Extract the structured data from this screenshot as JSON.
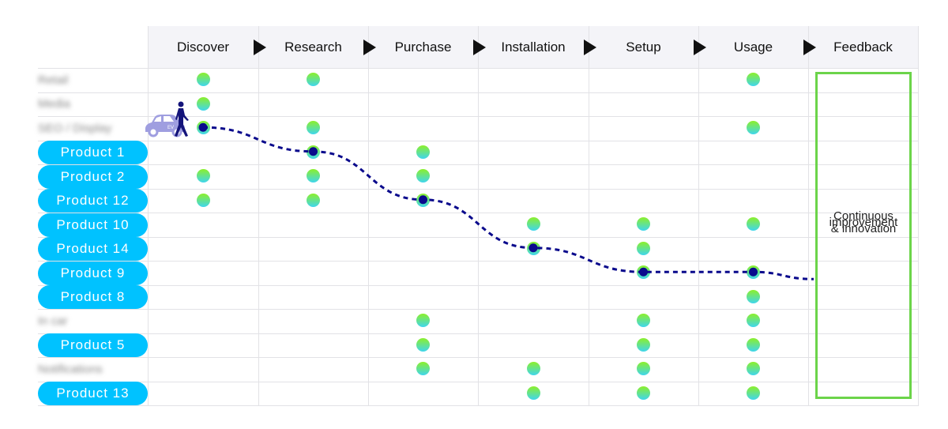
{
  "stages": [
    "Discover",
    "Research",
    "Purchase",
    "Installation",
    "Setup",
    "Usage",
    "Feedback"
  ],
  "rows": [
    {
      "label": "Retail",
      "style": "blur",
      "dots": [
        0,
        1,
        5
      ]
    },
    {
      "label": "Media",
      "style": "blur",
      "dots": [
        0
      ]
    },
    {
      "label": "SEO / Display",
      "style": "blur",
      "dots": [
        0,
        1,
        5
      ]
    },
    {
      "label": "Product 1",
      "style": "pill",
      "dots": [
        1,
        2
      ]
    },
    {
      "label": "Product 2",
      "style": "pill",
      "dots": [
        0,
        1,
        2
      ]
    },
    {
      "label": "Product 12",
      "style": "pill",
      "dots": [
        0,
        1,
        2
      ]
    },
    {
      "label": "Product 10",
      "style": "pill",
      "dots": [
        3,
        4,
        5
      ]
    },
    {
      "label": "Product 14",
      "style": "pill",
      "dots": [
        3,
        4
      ]
    },
    {
      "label": "Product 9",
      "style": "pill",
      "dots": [
        4,
        5
      ]
    },
    {
      "label": "Product 8",
      "style": "pill",
      "dots": [
        5
      ]
    },
    {
      "label": "In car",
      "style": "blur",
      "dots": [
        2,
        4,
        5
      ]
    },
    {
      "label": "Product 5",
      "style": "pill",
      "dots": [
        2,
        4,
        5
      ]
    },
    {
      "label": "Notifications",
      "style": "blur",
      "dots": [
        2,
        3,
        4,
        5
      ]
    },
    {
      "label": "Product 13",
      "style": "pill",
      "dots": [
        3,
        4,
        5
      ]
    }
  ],
  "journey": [
    {
      "stage": 0,
      "row": 2
    },
    {
      "stage": 1,
      "row": 3
    },
    {
      "stage": 2,
      "row": 5
    },
    {
      "stage": 3,
      "row": 7
    },
    {
      "stage": 4,
      "row": 8
    },
    {
      "stage": 5,
      "row": 8
    }
  ],
  "feedback": {
    "text_lines": [
      "Continuous",
      "improvement",
      "& innovation"
    ]
  },
  "icons": {
    "traveler": "person-walking-icon",
    "vehicle": "ev-car-icon",
    "vehicle_badge": "EV"
  },
  "colors": {
    "pill": "#00c2ff",
    "dot_top": "#8cf02a",
    "dot_bottom": "#3fd6ee",
    "path": "#0a0a8c",
    "feedback_border": "#6cd44a",
    "header_bg": "#f4f4f8"
  }
}
